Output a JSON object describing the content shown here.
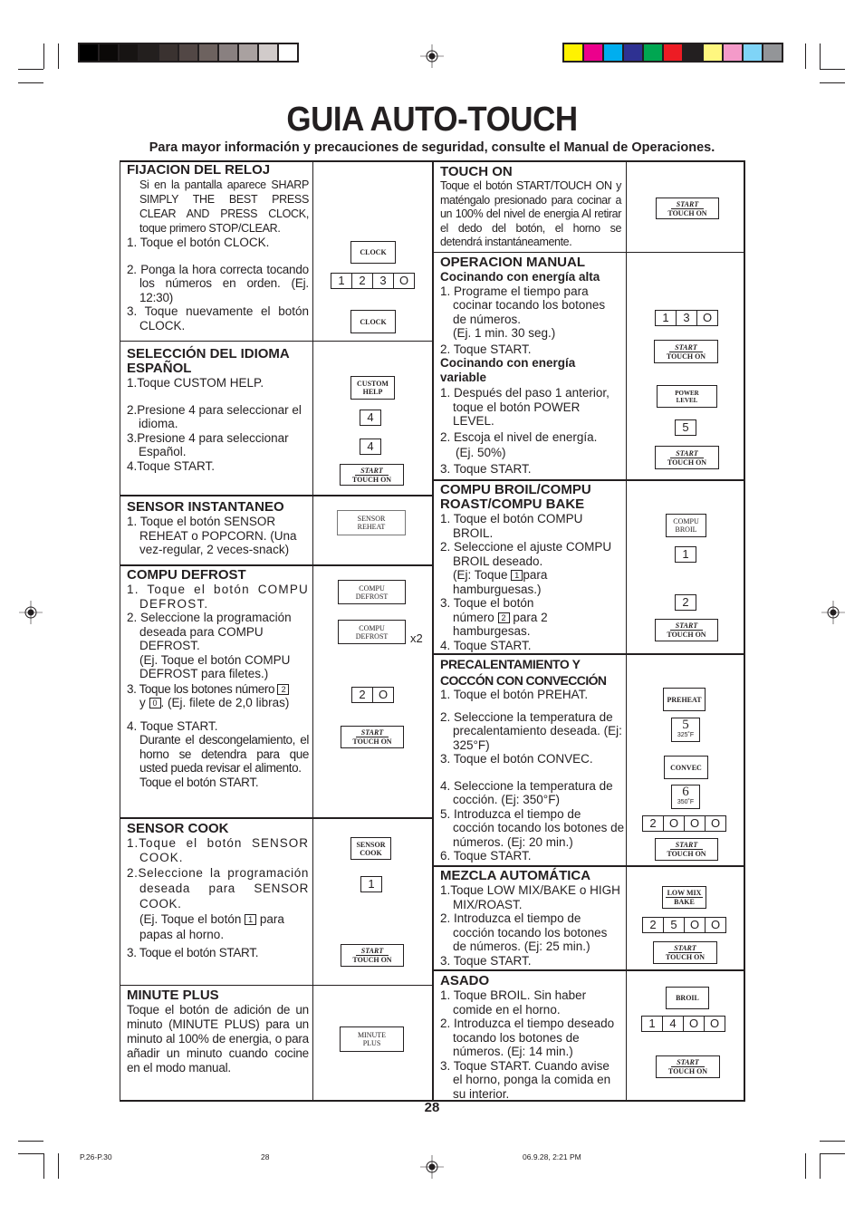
{
  "print_marks": {
    "gray_swatches": [
      "#000000",
      "#0b0908",
      "#171413",
      "#231f1e",
      "#3a3230",
      "#524745",
      "#6d625f",
      "#898080",
      "#a9a1a0",
      "#d1cbca",
      "#ffffff"
    ],
    "color_swatches": [
      "#fff200",
      "#ec008c",
      "#00aeef",
      "#2e3192",
      "#00a651",
      "#ed1c24",
      "#231f20",
      "#fff77f",
      "#f49ac9",
      "#7fd4f7",
      "#939598"
    ]
  },
  "header": {
    "title": "GUIA AUTO-TOUCH",
    "subtitle": "Para mayor información y precauciones de seguridad, consulte el Manual de Operaciones."
  },
  "sections": {
    "fijacion": {
      "title": "FIJACION DEL RELOJ",
      "note": "Si en la pantalla aparece SHARP SIMPLY THE BEST  PRESS CLEAR AND PRESS CLOCK, toque primero STOP/CLEAR.",
      "steps": [
        "1. Toque el botón CLOCK.",
        "2. Ponga la hora correcta tocando los números en orden. (Ej. 12:30)",
        "3. Toque nuevamente el botón CLOCK."
      ],
      "keys": {
        "clock": "CLOCK",
        "digits": [
          "1",
          "2",
          "3",
          "O"
        ]
      }
    },
    "idioma": {
      "title_l1": "SELECCIÓN DEL IDIOMA",
      "title_l2": "ESPAÑOL",
      "steps": [
        "1.Toque CUSTOM HELP.",
        "2.Presione 4 para seleccionar el idioma.",
        "3.Presione 4 para seleccionar Español.",
        "4.Toque START."
      ],
      "keys": {
        "custom_l1": "CUSTOM",
        "custom_l2": "HELP",
        "digit": "4"
      }
    },
    "sensor_inst": {
      "title": "SENSOR INSTANTANEO",
      "steps": [
        "1. Toque el botón SENSOR REHEAT o POPCORN. (Una vez-regular, 2 veces-snack)"
      ],
      "keys": {
        "l1": "SENSOR",
        "l2": "REHEAT"
      }
    },
    "defrost": {
      "title": "COMPU DEFROST",
      "steps": [
        "1. Toque el botón COMPU DEFROST.",
        "2. Seleccione la programación deseada para COMPU DEFROST.",
        "(Ej. Toque el botón COMPU DEFROST para filetes.)",
        "3. Toque los botones número",
        "y",
        ". (Ej. filete de 2,0 libras)",
        "4. Toque START.",
        "Durante el descongelamiento, el horno se detendra para que usted pueda revisar el alimento.",
        "Toque el botón START."
      ],
      "inline_digits": [
        "2",
        "0"
      ],
      "keys": {
        "l1": "COMPU",
        "l2": "DEFROST",
        "times": "x2",
        "digits": [
          "2",
          "O"
        ]
      }
    },
    "sensor_cook": {
      "title": "SENSOR COOK",
      "steps": [
        "1.Toque el botón SENSOR COOK.",
        "2.Seleccione la programación deseada para SENSOR COOK.",
        "(Ej. Toque el botón",
        "para papas al horno.",
        "3. Toque el botón START."
      ],
      "inline_digit": "1",
      "keys": {
        "l1": "SENSOR",
        "l2": "COOK",
        "digit": "1"
      }
    },
    "minute_plus": {
      "title": "MINUTE PLUS",
      "text": "Toque el botón de adición de un minuto (MINUTE PLUS) para un minuto al 100% de energia, o para añadir un minuto cuando cocine en el modo manual.",
      "keys": {
        "l1": "MINUTE",
        "l2": "PLUS"
      }
    },
    "touch_on": {
      "title": "TOUCH ON",
      "text": "Toque el botón START/TOUCH ON y maténgalo presionado para cocinar a un 100% del nivel de energia Al retirar el dedo del botón, el horno se detendrá instantáneamente."
    },
    "manual": {
      "title": "OPERACION MANUAL",
      "sub1": "Cocinando con energía alta",
      "steps1": [
        "1. Programe el tiempo para cocinar tocando los botones de números.",
        "(Ej. 1 min. 30 seg.)",
        "2. Toque START."
      ],
      "sub2_l1": "Cocinando con energía",
      "sub2_l2": "variable",
      "steps2": [
        "1. Después del paso 1 anterior, toque el botón POWER LEVEL.",
        "2. Escoja el nivel de energía.",
        "(Ej. 50%)",
        "3. Toque START."
      ],
      "keys": {
        "digits": [
          "1",
          "3",
          "O"
        ],
        "power_l1": "POWER",
        "power_l2": "LEVEL",
        "level": "5"
      }
    },
    "compu_broil": {
      "title_l1": "COMPU BROIL/COMPU",
      "title_l2": "ROAST/COMPU BAKE",
      "steps": [
        "1. Toque el botón COMPU BROIL.",
        "2. Seleccione el ajuste COMPU BROIL deseado.",
        "(Ej: Toque",
        "para",
        "hamburguesas.)",
        "3. Toque el botón",
        "número",
        "para 2",
        "hamburgesas.",
        "4. Toque START."
      ],
      "inline_digits": [
        "1",
        "2"
      ],
      "keys": {
        "l1": "COMPU",
        "l2": "BROIL",
        "d1": "1",
        "d2": "2"
      }
    },
    "convec": {
      "title_l1": "PRECALENTAMIENTO Y",
      "title_l2": "COCCÓN CON CONVECCIÓN",
      "steps": [
        "1. Toque el botón PREHAT.",
        "2. Seleccione la temperatura de precalentamiento deseada. (Ej: 325°F)",
        "3. Toque el botón CONVEC.",
        "4. Seleccione la temperatura de cocción. (Ej: 350°F)",
        "5. Introduzca el tiempo de cocción tocando los botones de números. (Ej: 20 min.)",
        "6. Toque START."
      ],
      "keys": {
        "preheat": "PREHEAT",
        "t1": "5",
        "t1_sub": "325˚F",
        "convec": "CONVEC",
        "t2": "6",
        "t2_sub": "350˚F",
        "digits": [
          "2",
          "O",
          "O",
          "O"
        ]
      }
    },
    "mezcla": {
      "title": "MEZCLA AUTOMÁTICA",
      "steps": [
        "1.Toque LOW MIX/BAKE o HIGH MIX/ROAST.",
        "2. Introduzca el tiempo de cocción tocando los botones de números. (Ej: 25 min.)",
        "3. Toque START."
      ],
      "keys": {
        "l1": "LOW MIX",
        "l2": "BAKE",
        "digits": [
          "2",
          "5",
          "O",
          "O"
        ]
      }
    },
    "asado": {
      "title": "ASADO",
      "steps": [
        "1. Toque BROIL. Sin haber comide en el horno.",
        "2. Introduzca el tiempo deseado tocando los botones de números. (Ej: 14 min.)",
        "3. Toque START. Cuando avise el horno, ponga la comida en su interior."
      ],
      "keys": {
        "broil": "BROIL",
        "digits": [
          "1",
          "4",
          "O",
          "O"
        ]
      }
    }
  },
  "start_key": {
    "l1": "START",
    "l2": "TOUCH ON"
  },
  "page_number": "28",
  "footer": {
    "left": "P.26-P.30",
    "center": "28",
    "right": "06.9.28, 2:21 PM"
  }
}
